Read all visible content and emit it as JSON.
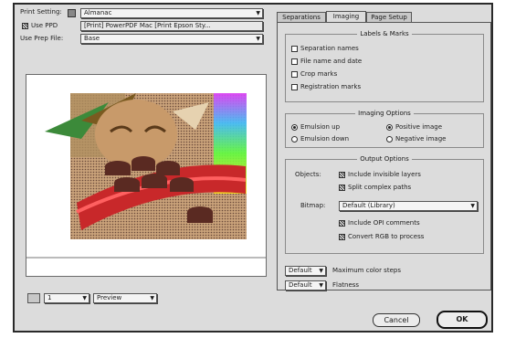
{
  "left": {
    "print_settings_label": "Print Setting:",
    "print_settings_value": "Almanac",
    "use_ppd_label": "Use PPD",
    "ppd_value": "[Print] PowerPDF Mac [Print Epson Sty...",
    "use_prep_file_label": "Use Prep File:",
    "prep_file_value": "Base",
    "page_number": "1",
    "view_mode": "Preview"
  },
  "tabs": [
    "Separations",
    "Imaging",
    "Page Setup"
  ],
  "active_tab": "Imaging",
  "labels_marks": {
    "title": "Labels & Marks",
    "items": [
      {
        "label": "Separation names",
        "checked": false
      },
      {
        "label": "File name and date",
        "checked": false
      },
      {
        "label": "Crop marks",
        "checked": false
      },
      {
        "label": "Registration marks",
        "checked": false
      }
    ]
  },
  "imaging_options": {
    "title": "Imaging Options",
    "emulsion_up": "Emulsion up",
    "emulsion_down": "Emulsion down",
    "positive_image": "Positive image",
    "negative_image": "Negative image"
  },
  "output_options": {
    "title": "Output Options",
    "objects_label": "Objects:",
    "include_invisible": "Include invisible layers",
    "split_paths": "Split complex paths",
    "bitmap_label": "Bitmap:",
    "bitmap_value": "Default (Library)",
    "include_opi": "Include OPI comments",
    "convert_rgb": "Convert RGB to process"
  },
  "steps": {
    "value": "Default",
    "label": "Maximum color steps"
  },
  "flatness": {
    "value": "Default",
    "label": "Flatness"
  },
  "buttons": {
    "cancel": "Cancel",
    "ok": "OK"
  }
}
